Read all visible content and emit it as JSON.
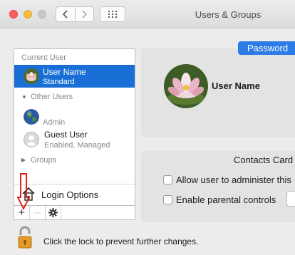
{
  "window": {
    "title": "Users & Groups"
  },
  "icons": {
    "back": "chevron-left-icon",
    "forward": "chevron-right-icon",
    "grid": "grid-icon",
    "add": "plus-icon",
    "remove": "minus-icon",
    "action": "gear-icon",
    "lock": "lock-icon",
    "house": "house-icon",
    "arrow": "arrow-down-icon"
  },
  "colors": {
    "selection": "#1a6fd6",
    "accent_tab": "#2d7be6",
    "annotation_arrow": "#e0251b"
  },
  "sidebar": {
    "current_user_header": "Current User",
    "current_user": {
      "name": "User Name",
      "role": "Standard"
    },
    "other_users_header": "Other Users",
    "other_users": [
      {
        "name": "",
        "role": "Admin"
      },
      {
        "name": "Guest User",
        "role": "Enabled, Managed"
      }
    ],
    "groups_header": "Groups",
    "login_options": "Login Options",
    "add_button": "+",
    "remove_button": "—"
  },
  "main": {
    "tab_password": "Password",
    "user_name": "User Name",
    "contacts_card": "Contacts Card",
    "allow_admin": "Allow user to administer this",
    "parental_controls": "Enable parental controls"
  },
  "footer": {
    "lock_text": "Click the lock to prevent further changes."
  }
}
